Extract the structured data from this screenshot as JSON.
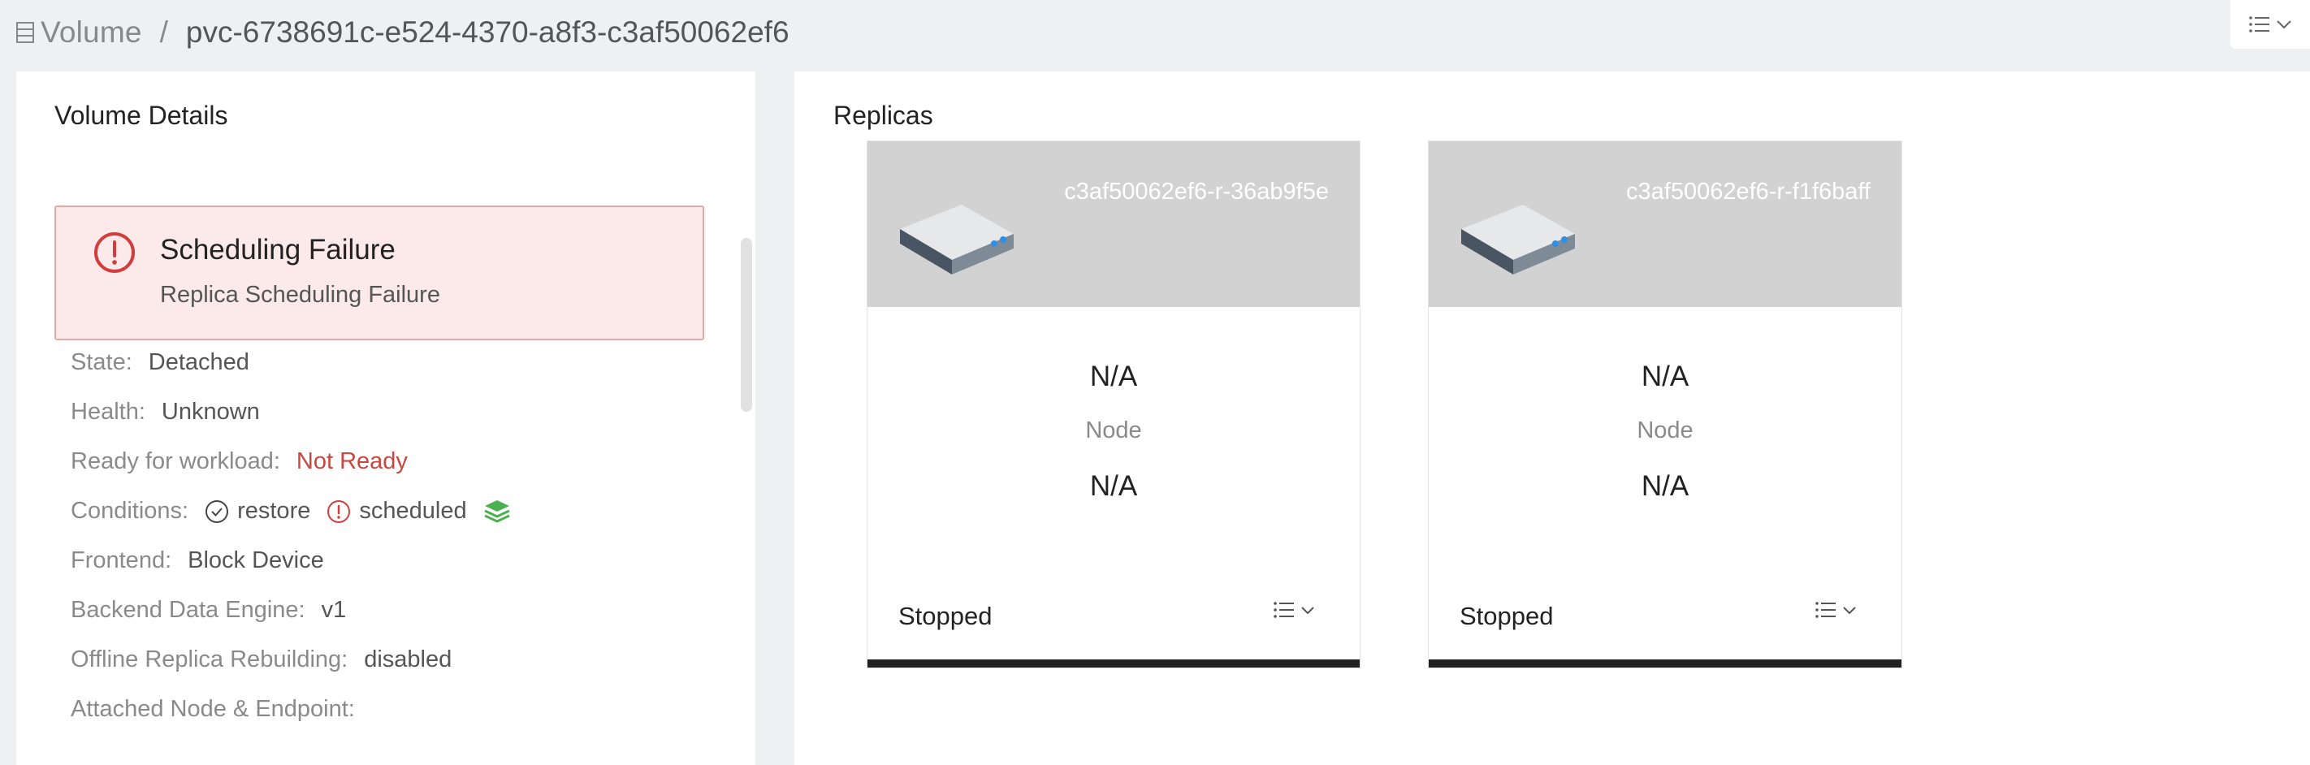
{
  "breadcrumb": {
    "root": "Volume",
    "separator": "/",
    "current": "pvc-6738691c-e524-4370-a8f3-c3af50062ef6"
  },
  "volume_details": {
    "title": "Volume Details",
    "alert": {
      "title": "Scheduling Failure",
      "description": "Replica Scheduling Failure"
    },
    "fields": [
      {
        "label": "State:",
        "value": "Detached"
      },
      {
        "label": "Health:",
        "value": "Unknown"
      },
      {
        "label": "Ready for workload:",
        "value": "Not Ready"
      },
      {
        "label": "Conditions:",
        "conditions": [
          "restore",
          "scheduled"
        ]
      },
      {
        "label": "Frontend:",
        "value": "Block Device"
      },
      {
        "label": "Backend Data Engine:",
        "value": "v1"
      },
      {
        "label": "Offline Replica Rebuilding:",
        "value": "disabled"
      },
      {
        "label": "Attached Node & Endpoint:",
        "value": ""
      }
    ]
  },
  "replicas": {
    "title": "Replicas",
    "items": [
      {
        "name": "c3af50062ef6-r-36ab9f5e",
        "node_value": "N/A",
        "node_label": "Node",
        "path_value": "N/A",
        "status": "Stopped"
      },
      {
        "name": "c3af50062ef6-r-f1f6baff",
        "node_value": "N/A",
        "node_label": "Node",
        "path_value": "N/A",
        "status": "Stopped"
      }
    ]
  },
  "colors": {
    "danger": "#c9473f",
    "success": "#4caf50",
    "card_header": "#d2d2d2",
    "status_bar": "#222222"
  },
  "icons": {
    "breadcrumb": "volume-icon",
    "alert": "exclamation-circle-icon",
    "condition_ok": "check-circle-icon",
    "condition_fail": "exclamation-circle-icon",
    "snapshot": "layers-icon",
    "disk": "disk-drive-icon",
    "menu": "list-dropdown-icon"
  }
}
